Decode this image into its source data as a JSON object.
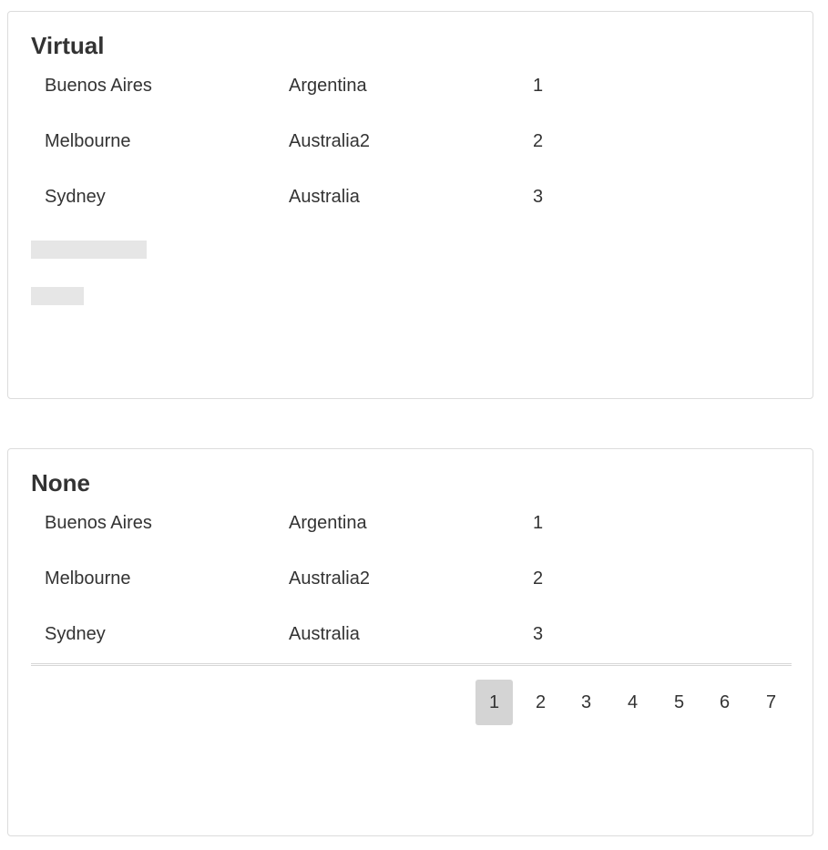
{
  "grids": {
    "virtual": {
      "title": "Virtual",
      "rows": [
        {
          "city": "Buenos Aires",
          "country": "Argentina",
          "id": "1"
        },
        {
          "city": "Melbourne",
          "country": "Australia2",
          "id": "2"
        },
        {
          "city": "Sydney",
          "country": "Australia",
          "id": "3"
        }
      ]
    },
    "none": {
      "title": "None",
      "rows": [
        {
          "city": "Buenos Aires",
          "country": "Argentina",
          "id": "1"
        },
        {
          "city": "Melbourne",
          "country": "Australia2",
          "id": "2"
        },
        {
          "city": "Sydney",
          "country": "Australia",
          "id": "3"
        }
      ],
      "pager": {
        "pages": [
          "1",
          "2",
          "3",
          "4",
          "5",
          "6",
          "7"
        ],
        "current": "1"
      }
    }
  },
  "colors": {
    "active_page_bg": "#d4d4d4",
    "placeholder": "#e6e6e6",
    "border": "#dcdcdc",
    "text": "#333333"
  }
}
